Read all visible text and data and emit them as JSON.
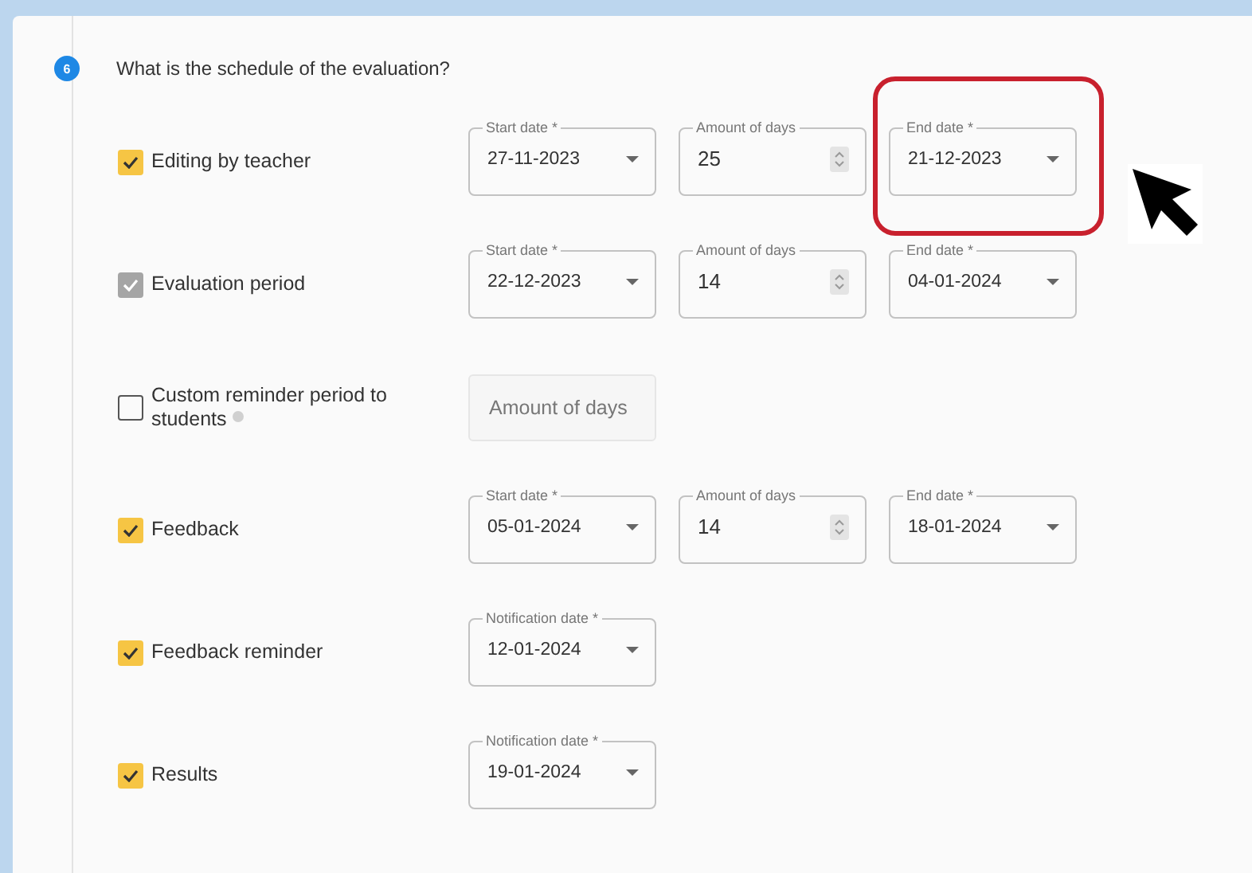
{
  "step": {
    "number": "6",
    "question": "What is the schedule of the evaluation?"
  },
  "rows": [
    {
      "label": "Editing by teacher",
      "checked": true,
      "disabled": false,
      "info": false,
      "fields": [
        {
          "kind": "date",
          "label": "Start date *",
          "value": "27-11-2023"
        },
        {
          "kind": "number",
          "label": "Amount of days",
          "value": "25"
        },
        {
          "kind": "date",
          "label": "End date *",
          "value": "21-12-2023",
          "highlighted": true
        }
      ]
    },
    {
      "label": "Evaluation period",
      "checked": true,
      "disabled": true,
      "info": false,
      "fields": [
        {
          "kind": "date",
          "label": "Start date *",
          "value": "22-12-2023"
        },
        {
          "kind": "number",
          "label": "Amount of days",
          "value": "14"
        },
        {
          "kind": "date",
          "label": "End date *",
          "value": "04-01-2024"
        }
      ]
    },
    {
      "label": "Custom reminder period to students",
      "checked": false,
      "disabled": false,
      "info": true,
      "fields": [
        {
          "kind": "empty",
          "placeholder": "Amount of days"
        }
      ]
    },
    {
      "label": "Feedback",
      "checked": true,
      "disabled": false,
      "info": false,
      "fields": [
        {
          "kind": "date",
          "label": "Start date *",
          "value": "05-01-2024"
        },
        {
          "kind": "number",
          "label": "Amount of days",
          "value": "14"
        },
        {
          "kind": "date",
          "label": "End date *",
          "value": "18-01-2024"
        }
      ]
    },
    {
      "label": "Feedback reminder",
      "checked": true,
      "disabled": false,
      "info": false,
      "fields": [
        {
          "kind": "date",
          "label": "Notification date *",
          "value": "12-01-2024"
        }
      ]
    },
    {
      "label": "Results",
      "checked": true,
      "disabled": false,
      "info": false,
      "fields": [
        {
          "kind": "date",
          "label": "Notification date *",
          "value": "19-01-2024"
        }
      ]
    }
  ]
}
